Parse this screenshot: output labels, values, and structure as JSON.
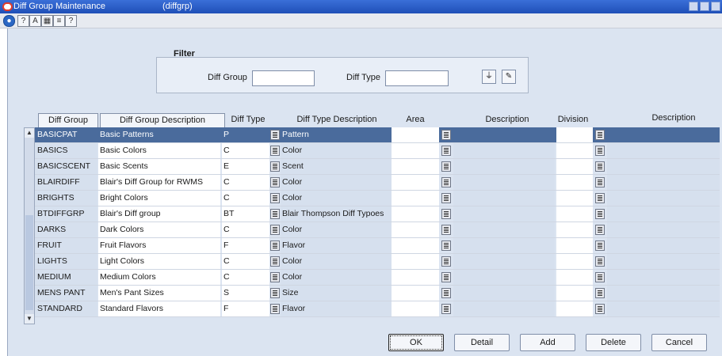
{
  "window": {
    "title": "Diff Group Maintenance",
    "program": "(diffgrp)"
  },
  "toolbar": {
    "icons": [
      "globe-icon",
      "help-icon",
      "spell-icon",
      "calendar-icon",
      "notes-icon",
      "info-icon"
    ]
  },
  "filter": {
    "title": "Filter",
    "diff_group_label": "Diff Group",
    "diff_group_value": "",
    "diff_type_label": "Diff Type",
    "diff_type_value": ""
  },
  "table": {
    "headers": {
      "diff_group": "Diff Group",
      "diff_group_description": "Diff Group Description",
      "diff_type": "Diff Type",
      "diff_type_description": "Diff Type Description",
      "area": "Area",
      "area_description": "Description",
      "division": "Division",
      "division_description": "Description"
    },
    "rows": [
      {
        "group": "BASICPAT",
        "desc": "Basic Patterns",
        "type": "P",
        "type_desc": "Pattern"
      },
      {
        "group": "BASICS",
        "desc": "Basic Colors",
        "type": "C",
        "type_desc": "Color"
      },
      {
        "group": "BASICSCENT",
        "desc": "Basic Scents",
        "type": "E",
        "type_desc": "Scent"
      },
      {
        "group": "BLAIRDIFF",
        "desc": "Blair's Diff Group for RWMS",
        "type": "C",
        "type_desc": "Color"
      },
      {
        "group": "BRIGHTS",
        "desc": "Bright Colors",
        "type": "C",
        "type_desc": "Color"
      },
      {
        "group": "BTDIFFGRP",
        "desc": "Blair's Diff group",
        "type": "BT",
        "type_desc": "Blair Thompson Diff Typoes"
      },
      {
        "group": "DARKS",
        "desc": "Dark Colors",
        "type": "C",
        "type_desc": "Color"
      },
      {
        "group": "FRUIT",
        "desc": "Fruit Flavors",
        "type": "F",
        "type_desc": "Flavor"
      },
      {
        "group": "LIGHTS",
        "desc": "Light Colors",
        "type": "C",
        "type_desc": "Color"
      },
      {
        "group": "MEDIUM",
        "desc": "Medium Colors",
        "type": "C",
        "type_desc": "Color"
      },
      {
        "group": "MENS PANT",
        "desc": "Men's Pant Sizes",
        "type": "S",
        "type_desc": "Size"
      },
      {
        "group": "STANDARD",
        "desc": "Standard Flavors",
        "type": "F",
        "type_desc": "Flavor"
      }
    ]
  },
  "buttons": {
    "ok": "OK",
    "detail": "Detail",
    "add": "Add",
    "delete": "Delete",
    "cancel": "Cancel"
  }
}
